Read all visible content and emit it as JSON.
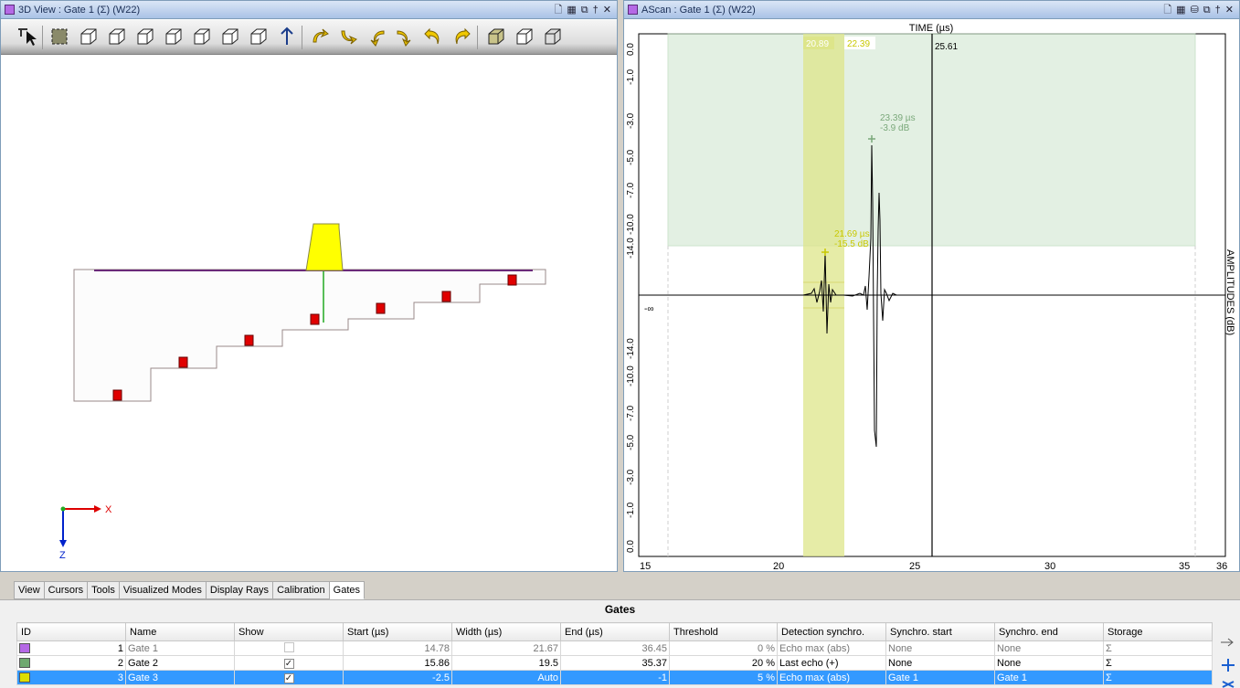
{
  "view3d": {
    "title": "3D View  : Gate 1 (Σ) (W22)",
    "axis_x": "X",
    "axis_z": "Z"
  },
  "ascan": {
    "title": "AScan  : Gate 1 (Σ) (W22)",
    "time_label": "TIME (µs)",
    "amp_label": "AMPLITUDES (dB)",
    "neg_inf": "-∞",
    "gate_start_label": "20.89",
    "gate_end_label": "22.39",
    "cursor_label": "25.61",
    "peak1_time": "23.39 µs",
    "peak1_db": "-3.9 dB",
    "peak2_time": "21.69 µs",
    "peak2_db": "-15.5 dB",
    "x_ticks": [
      "15",
      "20",
      "25",
      "30",
      "35",
      "36"
    ],
    "y_ticks_top": [
      "0.0",
      "-1.0",
      "-3.0",
      "-5.0",
      "-7.0",
      "-10.0",
      "-14.0"
    ],
    "y_ticks_bottom": [
      "-14.0",
      "-10.0",
      "-7.0",
      "-5.0",
      "-3.0",
      "-1.0",
      "0.0"
    ]
  },
  "tabs": [
    "View",
    "Cursors",
    "Tools",
    "Visualized Modes",
    "Display Rays",
    "Calibration",
    "Gates"
  ],
  "gates": {
    "title": "Gates",
    "headers": [
      "ID",
      "Name",
      "Show",
      "Start (µs)",
      "Width (µs)",
      "End (µs)",
      "Threshold",
      "Detection synchro.",
      "Synchro. start",
      "Synchro. end",
      "Storage"
    ],
    "rows": [
      {
        "color": "#b569e6",
        "id": "1",
        "name": "Gate 1",
        "show": "",
        "start": "14.78",
        "width": "21.67",
        "end": "36.45",
        "threshold": "0 %",
        "detection": "Echo max (abs)",
        "sync_start": "None",
        "sync_end": "None",
        "storage": "Σ"
      },
      {
        "color": "#6fa86f",
        "id": "2",
        "name": "Gate 2",
        "show": "✓",
        "start": "15.86",
        "width": "19.5",
        "end": "35.37",
        "threshold": "20 %",
        "detection": "Last echo (+)",
        "sync_start": "None",
        "sync_end": "None",
        "storage": "Σ"
      },
      {
        "color": "#dddd00",
        "id": "3",
        "name": "Gate 3",
        "show": "✓",
        "start": "-2.5",
        "width": "Auto",
        "end": "-1",
        "threshold": "5 %",
        "detection": "Echo max (abs)",
        "sync_start": "Gate 1",
        "sync_end": "Gate 1",
        "storage": "Σ"
      }
    ]
  }
}
